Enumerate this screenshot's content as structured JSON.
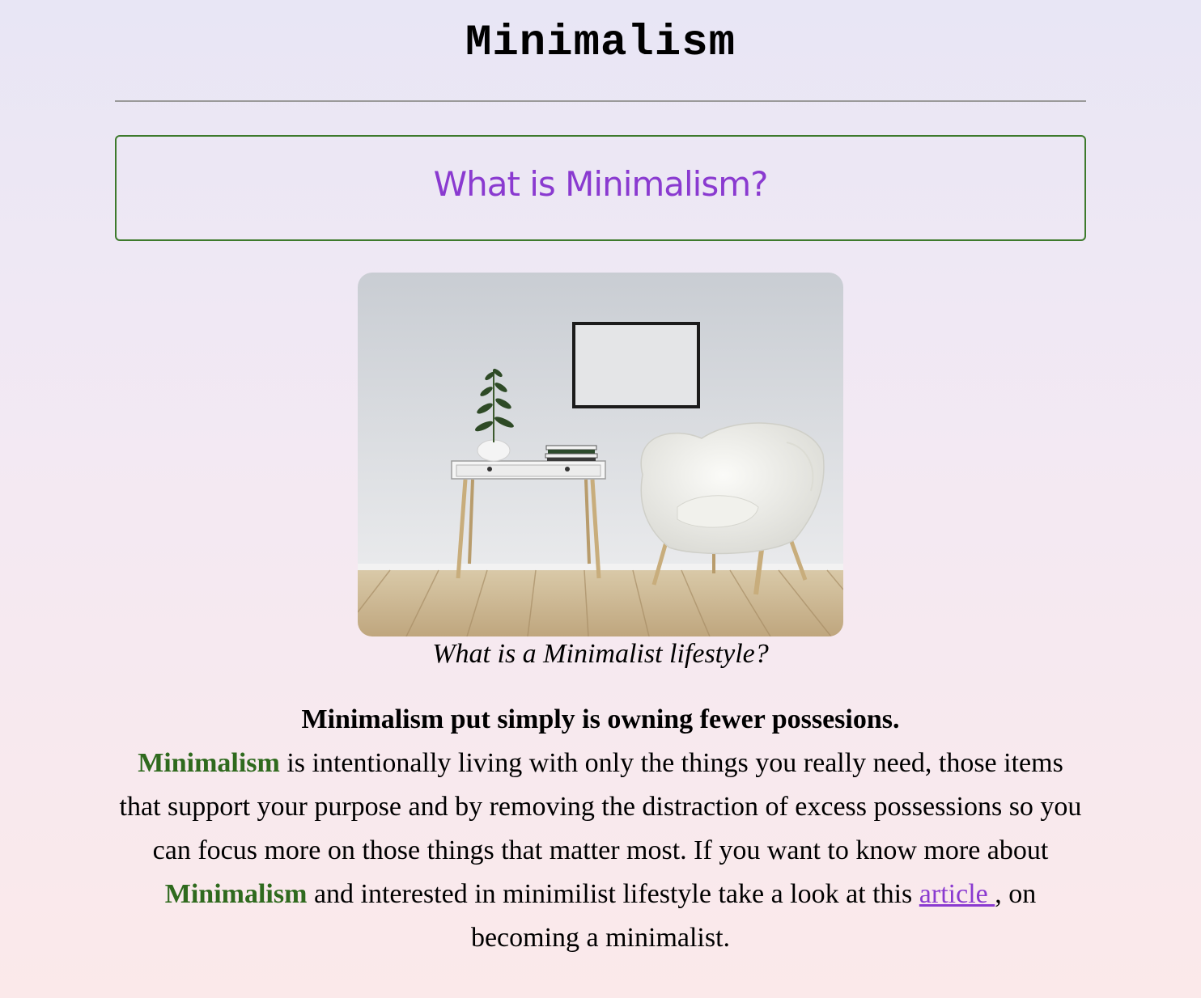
{
  "header": {
    "title": "Minimalism"
  },
  "section": {
    "heading": "What is Minimalism?"
  },
  "figure": {
    "caption": "What is a Minimalist lifestyle?"
  },
  "content": {
    "lead": "Minimalism put simply is owning fewer possesions.",
    "highlight_1": "Minimalism",
    "text_1": " is intentionally living with only the things you really need, those items that support your purpose and by removing the distraction of excess possessions so you can focus more on those things that matter most. If you want to know more about ",
    "highlight_2": "Minimalism",
    "text_2": " and interested in minimilist lifestyle take a look at this ",
    "link_label": "article ",
    "text_3": ", on becoming a minimalist."
  },
  "colors": {
    "heading": "#8a3ad0",
    "highlight": "#2f6a1e",
    "box_border": "#3d7a2c",
    "link": "#8a3ad0"
  }
}
